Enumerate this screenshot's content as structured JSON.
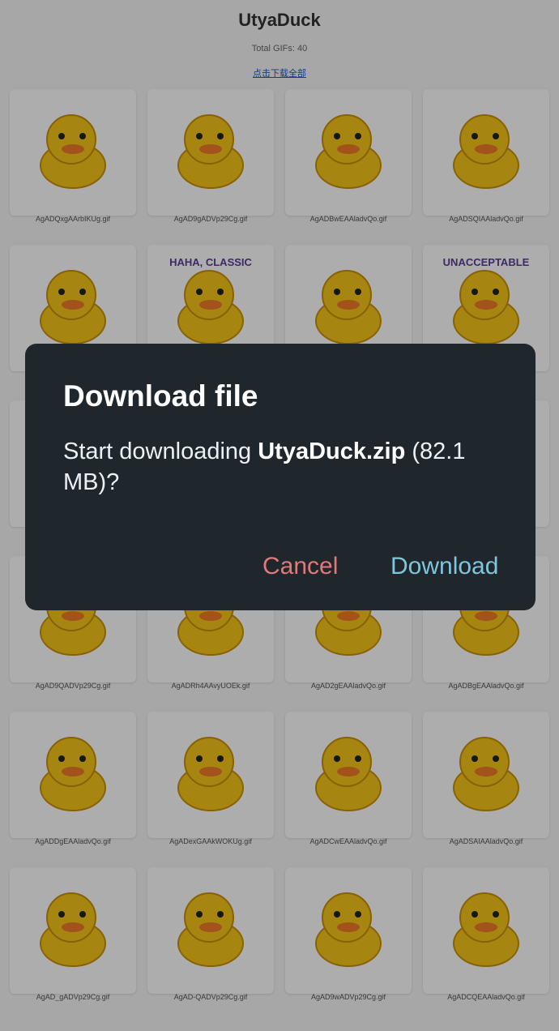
{
  "page": {
    "title": "UtyaDuck",
    "total_label": "Total GIFs: 40",
    "download_all_link": "点击下载全部"
  },
  "gifs": [
    {
      "file": "AgADQxgAArbIKUg.gif"
    },
    {
      "file": "AgAD9gADVp29Cg.gif"
    },
    {
      "file": "AgADBwEAAladvQo.gif"
    },
    {
      "file": "AgADSQIAAladvQo.gif"
    },
    {
      "file": ""
    },
    {
      "file": "",
      "caption": "HAHA, CLASSIC"
    },
    {
      "file": ""
    },
    {
      "file": "",
      "caption": "UNACCEPTABLE"
    },
    {
      "file": ""
    },
    {
      "file": ""
    },
    {
      "file": ""
    },
    {
      "file": ""
    },
    {
      "file": "AgAD9QADVp29Cg.gif"
    },
    {
      "file": "AgADRh4AAvyUOEk.gif"
    },
    {
      "file": "AgAD2gEAAladvQo.gif"
    },
    {
      "file": "AgADBgEAAladvQo.gif"
    },
    {
      "file": "AgADDgEAAladvQo.gif"
    },
    {
      "file": "AgADexGAAkWOKUg.gif"
    },
    {
      "file": "AgADCwEAAladvQo.gif"
    },
    {
      "file": "AgADSAIAAladvQo.gif"
    },
    {
      "file": "AgAD_gADVp29Cg.gif"
    },
    {
      "file": "AgAD-QADVp29Cg.gif"
    },
    {
      "file": "AgAD9wADVp29Cg.gif"
    },
    {
      "file": "AgADCQEAAladvQo.gif"
    }
  ],
  "dialog": {
    "title": "Download file",
    "message_prefix": "Start downloading ",
    "filename": "UtyaDuck.zip",
    "message_suffix": " (82.1 MB)?",
    "cancel_label": "Cancel",
    "download_label": "Download"
  },
  "colors": {
    "duck_yellow": "#f5c518",
    "dialog_bg": "#1f262c",
    "cancel": "#e07a7a",
    "download": "#7fc6dc"
  }
}
